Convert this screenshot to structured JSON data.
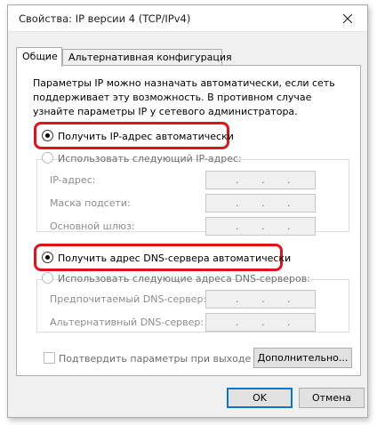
{
  "window": {
    "title": "Свойства: IP версии 4 (TCP/IPv4)"
  },
  "tabs": [
    {
      "label": "Общие"
    },
    {
      "label": "Альтернативная конфигурация"
    }
  ],
  "description": "Параметры IP можно назначать автоматически, если сеть поддерживает эту возможность. В противном случае узнайте параметры IP у сетевого администратора.",
  "ip": {
    "auto_label": "Получить IP-адрес автоматически",
    "manual_label": "Использовать следующий IP-адрес:",
    "fields": [
      {
        "label": "IP-адрес:",
        "value": ".     .     ."
      },
      {
        "label": "Маска подсети:",
        "value": ".     .     ."
      },
      {
        "label": "Основной шлюз:",
        "value": ".     .     ."
      }
    ]
  },
  "dns": {
    "auto_label": "Получить адрес DNS-сервера автоматически",
    "manual_label": "Использовать следующие адреса DNS-серверов:",
    "fields": [
      {
        "label": "Предпочитаемый DNS-сервер:",
        "value": ".     .     ."
      },
      {
        "label": "Альтернативный DNS-сервер:",
        "value": ".     .     ."
      }
    ]
  },
  "validate_label": "Подтвердить параметры при выходе",
  "buttons": {
    "advanced": "Дополнительно...",
    "ok": "OK",
    "cancel": "Отмена"
  },
  "colors": {
    "highlight": "#e0121a",
    "window_bg": "#f0f0f0",
    "panel_bg": "#ffffff",
    "disabled_text": "#8d8d8d"
  },
  "icons": {
    "close": "close-icon",
    "radio": "radio-icon",
    "checkbox": "checkbox-icon"
  }
}
